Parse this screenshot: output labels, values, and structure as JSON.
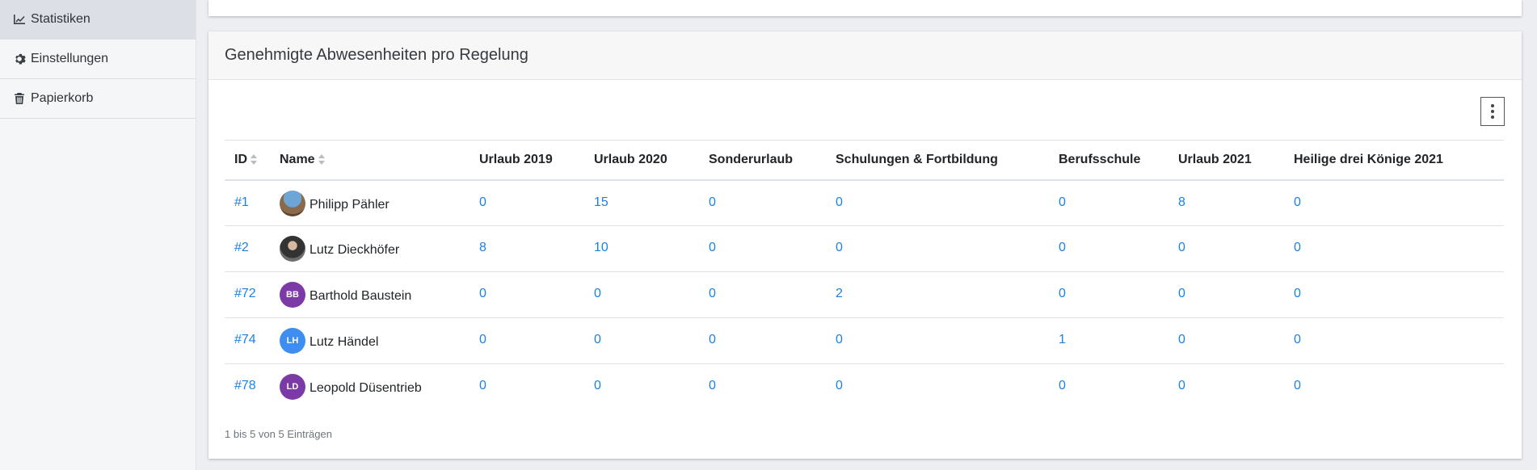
{
  "sidebar": {
    "items": [
      {
        "label": "Statistiken",
        "icon": "chart-line-icon",
        "active": true
      },
      {
        "label": "Einstellungen",
        "icon": "gear-icon",
        "active": false
      },
      {
        "label": "Papierkorb",
        "icon": "trash-icon",
        "active": false
      }
    ]
  },
  "card": {
    "title": "Genehmigte Abwesenheiten pro Regelung",
    "menu_icon": "kebab-menu-icon"
  },
  "table": {
    "headers": [
      "ID",
      "Name",
      "Urlaub 2019",
      "Urlaub 2020",
      "Sonderurlaub",
      "Schulungen & Fortbildung",
      "Berufsschule",
      "Urlaub 2021",
      "Heilige drei Könige 2021"
    ],
    "rows": [
      {
        "id": "#1",
        "name": "Philipp Pähler",
        "avatar": "",
        "values": [
          "0",
          "15",
          "0",
          "0",
          "0",
          "8",
          "0"
        ]
      },
      {
        "id": "#2",
        "name": "Lutz Dieckhöfer",
        "avatar": "",
        "values": [
          "8",
          "10",
          "0",
          "0",
          "0",
          "0",
          "0"
        ]
      },
      {
        "id": "#72",
        "name": "Barthold Baustein",
        "avatar": "BB",
        "values": [
          "0",
          "0",
          "0",
          "2",
          "0",
          "0",
          "0"
        ]
      },
      {
        "id": "#74",
        "name": "Lutz Händel",
        "avatar": "LH",
        "values": [
          "0",
          "0",
          "0",
          "0",
          "1",
          "0",
          "0"
        ]
      },
      {
        "id": "#78",
        "name": "Leopold Düsentrieb",
        "avatar": "LD",
        "values": [
          "0",
          "0",
          "0",
          "0",
          "0",
          "0",
          "0"
        ]
      }
    ]
  },
  "pagination_info": "1 bis 5 von 5 Einträgen",
  "colors": {
    "link": "#1a82e2",
    "avatar_purple": "#7b3aa6",
    "avatar_blue": "#3d8ef0"
  }
}
